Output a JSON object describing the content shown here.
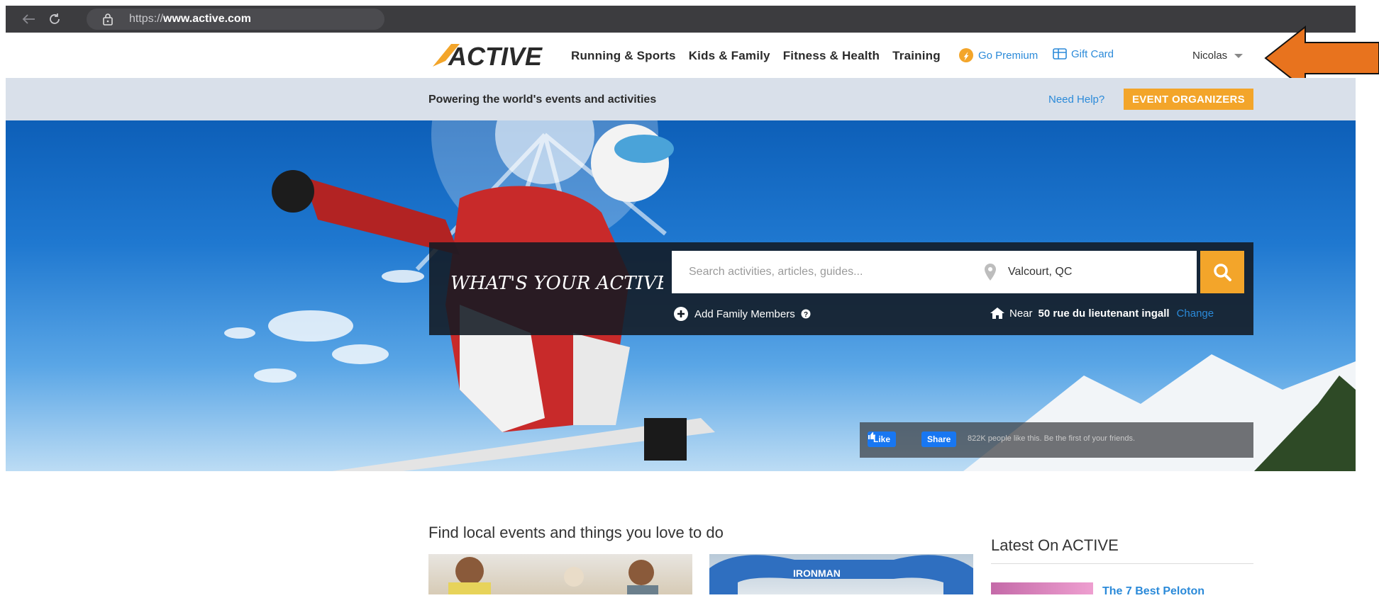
{
  "browser": {
    "back_icon": "back-arrow-icon",
    "reload_icon": "reload-icon",
    "url_prefix": "https://",
    "url_domain": "www.active.com"
  },
  "nav": {
    "logo": "ACTIVE",
    "links": [
      "Running & Sports",
      "Kids & Family",
      "Fitness & Health",
      "Training"
    ],
    "premium": "Go Premium",
    "gift_card": "Gift Card",
    "user": "Nicolas"
  },
  "subbar": {
    "tagline": "Powering the world's events and activities",
    "need_help": "Need Help?",
    "event_organizers": "EVENT ORGANIZERS"
  },
  "search": {
    "heading": "WHAT'S YOUR ACTIVE?",
    "placeholder": "Search activities, articles, guides...",
    "location": "Valcourt, QC",
    "add_family": "Add Family Members",
    "near_label": "Near",
    "near_address": "50 rue du lieutenant ingall",
    "change": "Change"
  },
  "facebook": {
    "like": "Like",
    "share": "Share",
    "text": "822K people like this. Be the first of your friends."
  },
  "content": {
    "find_title": "Find local events and things you love to do",
    "card2_banner": "IRONMAN",
    "latest_title": "Latest On ACTIVE",
    "article_title": "The 7 Best Peloton"
  },
  "colors": {
    "accent_orange": "#f3a52a",
    "link_blue": "#2b8ad9",
    "annotation_arrow": "#e8731e"
  }
}
